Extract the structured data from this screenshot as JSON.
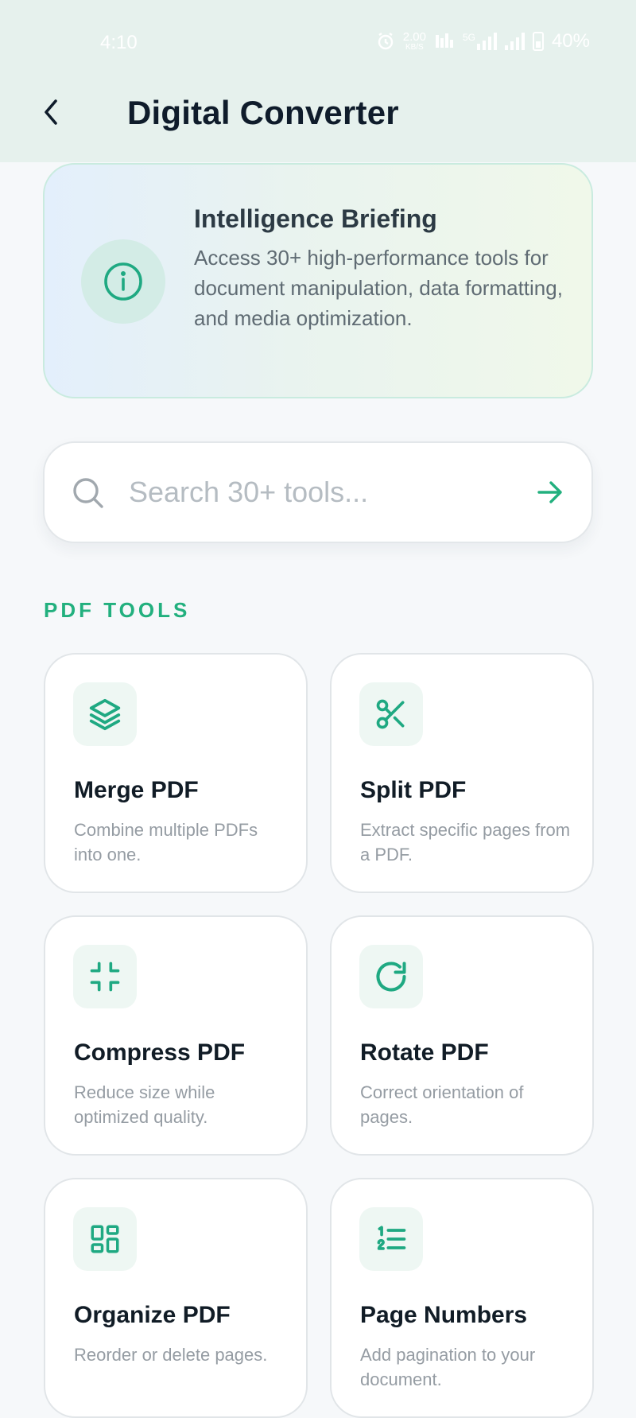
{
  "status_bar": {
    "time": "4:10",
    "speed_value": "2.00",
    "speed_unit": "KB/S",
    "network_label": "5G",
    "battery": "40%"
  },
  "header": {
    "title": "Digital Converter"
  },
  "briefing": {
    "title": "Intelligence Briefing",
    "text": "Access 30+ high-performance tools for document manipulation, data formatting, and media optimization."
  },
  "search": {
    "placeholder": "Search 30+ tools..."
  },
  "section": {
    "label": "PDF TOOLS"
  },
  "tools": [
    {
      "title": "Merge PDF",
      "desc": "Combine multiple PDFs into one.",
      "icon": "layers-icon"
    },
    {
      "title": "Split PDF",
      "desc": "Extract specific pages from a PDF.",
      "icon": "scissors-icon"
    },
    {
      "title": "Compress PDF",
      "desc": "Reduce size while optimized quality.",
      "icon": "minimize-icon"
    },
    {
      "title": "Rotate PDF",
      "desc": "Correct orientation of pages.",
      "icon": "rotate-icon"
    },
    {
      "title": "Organize PDF",
      "desc": "Reorder or delete pages.",
      "icon": "grid-icon"
    },
    {
      "title": "Page Numbers",
      "desc": "Add pagination to your document.",
      "icon": "list-ordered-icon"
    }
  ],
  "colors": {
    "accent": "#22b07e",
    "header_bg": "#e6f1ed",
    "page_bg": "#f6f8fa",
    "title_text": "#0f1c2b"
  }
}
